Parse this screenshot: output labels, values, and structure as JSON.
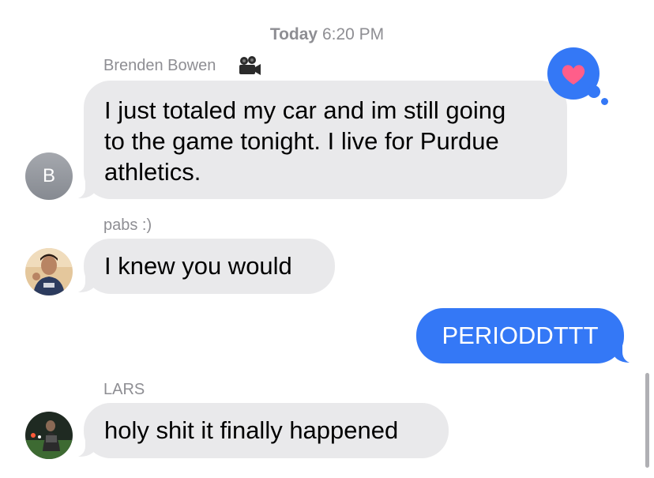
{
  "timestamp": {
    "day": "Today",
    "time": "6:20 PM"
  },
  "messages": [
    {
      "sender": "Brenden Bowen",
      "sender_icon": "video-camera-icon",
      "avatar_letter": "B",
      "lines": [
        "I just totaled my car and im still going",
        "to the game tonight. I live for Purdue",
        "athletics."
      ],
      "reaction": "heart-icon"
    },
    {
      "sender": "pabs :)",
      "text": "I knew you would"
    },
    {
      "outgoing": true,
      "text": "PERIODDTTT"
    },
    {
      "sender": "LARS",
      "text": "holy shit it finally happened"
    }
  ],
  "colors": {
    "incoming_bubble": "#e9e9eb",
    "outgoing_bubble": "#3478f6",
    "reaction_heart": "#ff5e8a",
    "meta_text": "#8e8e93"
  }
}
